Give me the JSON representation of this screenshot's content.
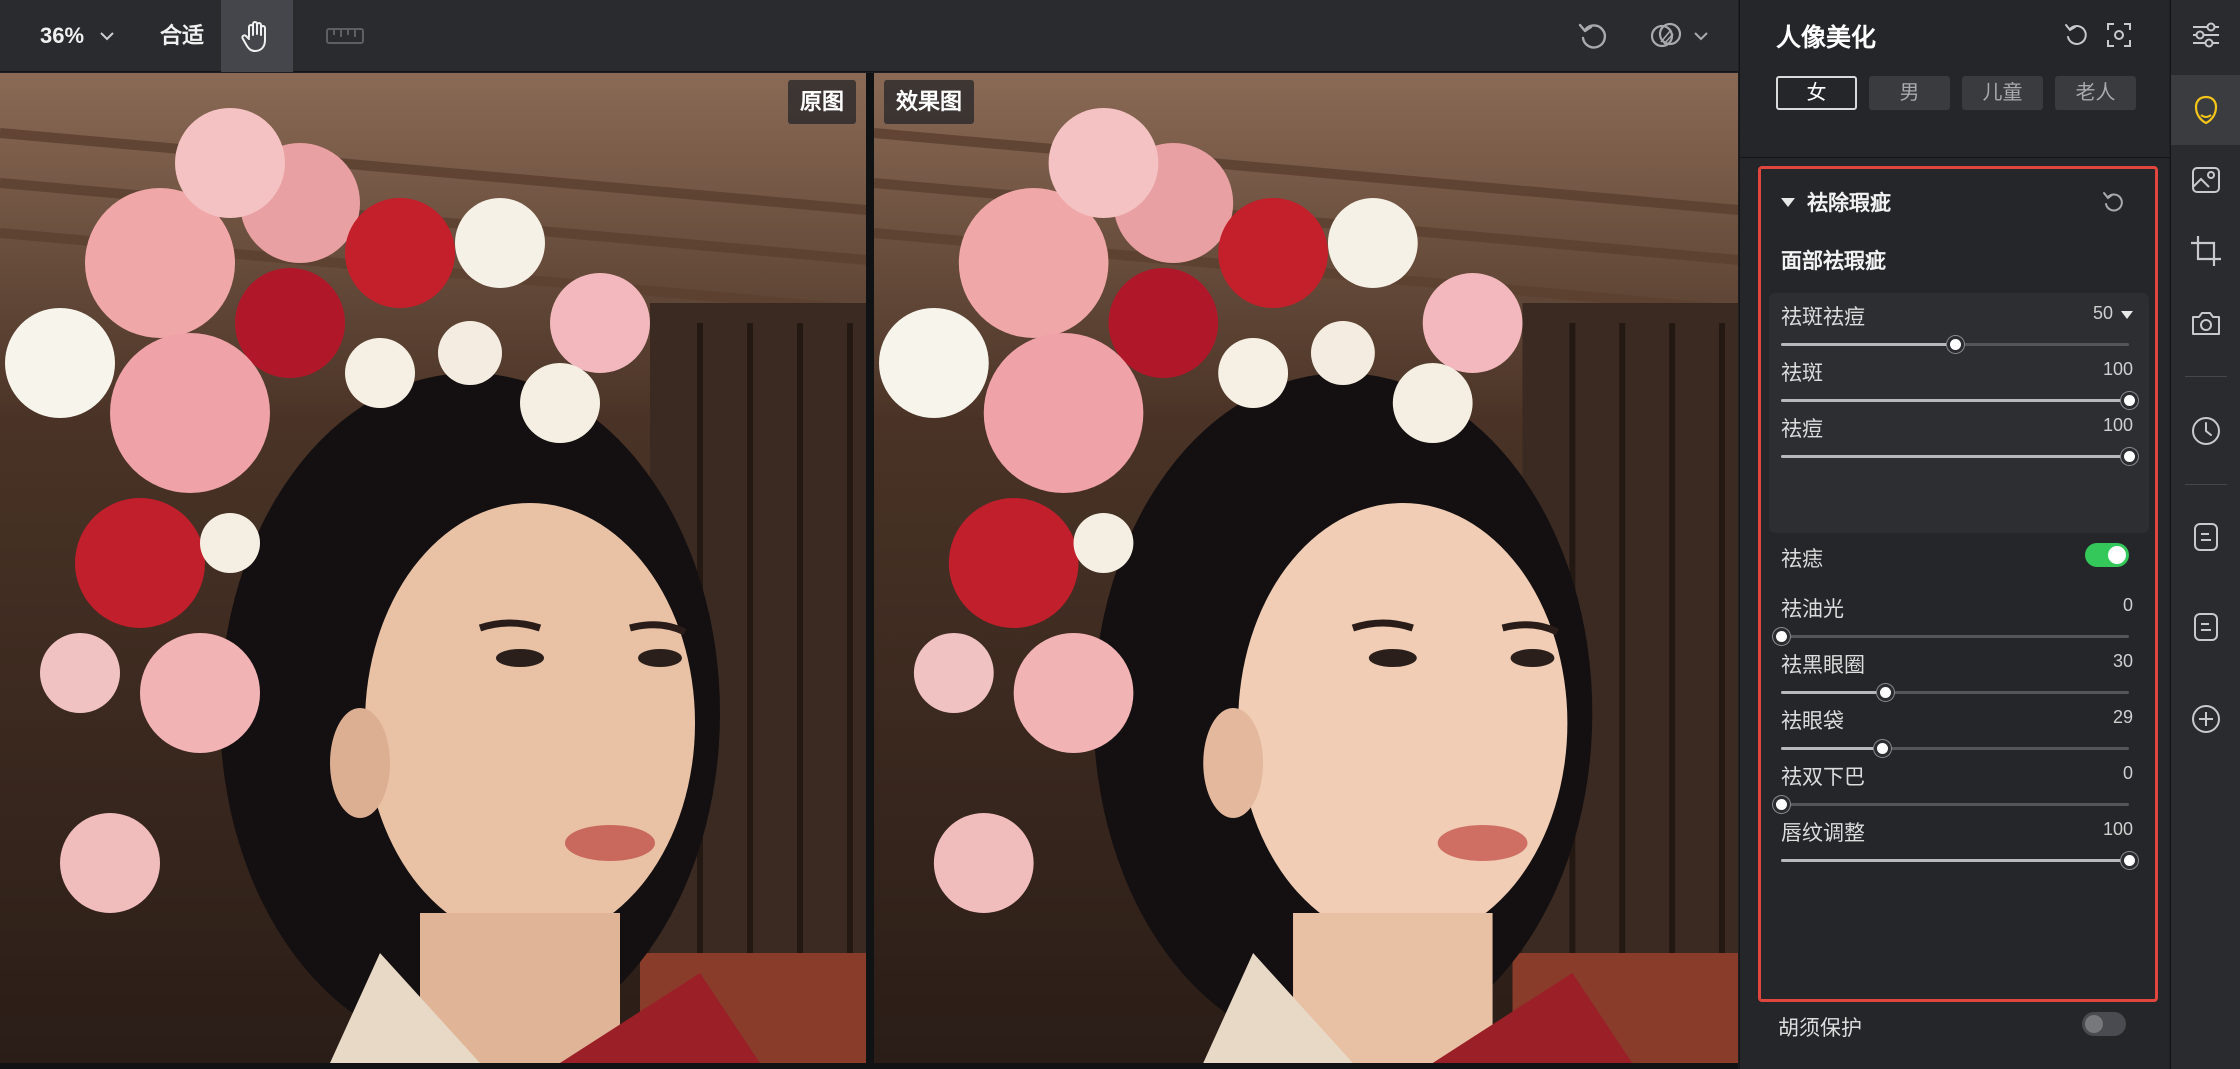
{
  "toolbar": {
    "zoom_value": "36%",
    "fit_label": "合适"
  },
  "canvas": {
    "original_label": "原图",
    "result_label": "效果图"
  },
  "panel": {
    "title": "人像美化",
    "gender_tabs": [
      {
        "label": "女",
        "active": true
      },
      {
        "label": "男",
        "active": false
      },
      {
        "label": "儿童",
        "active": false
      },
      {
        "label": "老人",
        "active": false
      }
    ],
    "section_title": "祛除瑕疵",
    "subsection_title": "面部祛瑕疵",
    "sliders_group": [
      {
        "label": "祛斑祛痘",
        "value": "50",
        "fraction": 0.5,
        "dropdown": true
      },
      {
        "label": "祛斑",
        "value": "100",
        "fraction": 1.0,
        "dropdown": false
      },
      {
        "label": "祛痘",
        "value": "100",
        "fraction": 1.0,
        "dropdown": false
      }
    ],
    "mole_toggle": {
      "label": "祛痣",
      "on": true
    },
    "sliders": [
      {
        "label": "祛油光",
        "value": "0",
        "fraction": 0.0
      },
      {
        "label": "祛黑眼圈",
        "value": "30",
        "fraction": 0.3
      },
      {
        "label": "祛眼袋",
        "value": "29",
        "fraction": 0.29
      },
      {
        "label": "祛双下巴",
        "value": "0",
        "fraction": 0.0
      },
      {
        "label": "唇纹调整",
        "value": "100",
        "fraction": 1.0
      }
    ],
    "beard_toggle": {
      "label": "胡须保护",
      "on": false
    }
  },
  "colors": {
    "accent_red": "#e0463d",
    "toggle_green": "#34c759",
    "active_tool_icon": "#f5c518"
  },
  "tool_strip": [
    "sliders-icon",
    "portrait-beauty-icon",
    "image-adjust-icon",
    "crop-icon",
    "camera-icon",
    "history-icon",
    "preset-list-icon",
    "preset-list-icon-2",
    "add-icon"
  ]
}
